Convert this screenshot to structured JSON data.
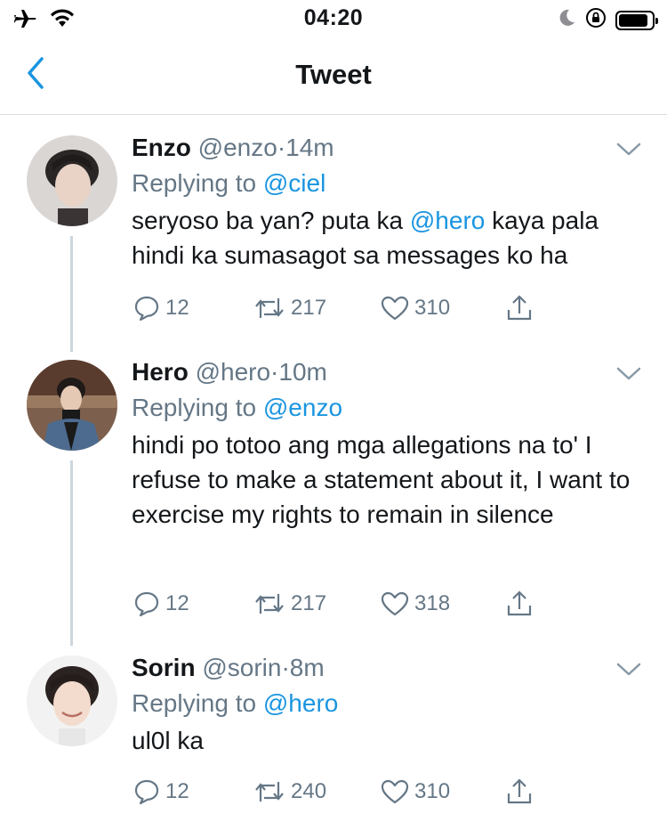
{
  "status_bar": {
    "time": "04:20",
    "icons": [
      "airplane-icon",
      "wifi-icon",
      "moon-icon",
      "orientation-lock-icon",
      "battery-icon"
    ],
    "battery_level": 0.9
  },
  "nav": {
    "title": "Tweet",
    "back_icon": "chevron-left-icon"
  },
  "colors": {
    "accent": "#1b95e0",
    "secondary_text": "#657786",
    "thread_line": "#ccd6dd"
  },
  "tweets": [
    {
      "name": "Enzo",
      "handle": "@enzo",
      "separator": "·",
      "time": "14m",
      "replying_prefix": "Replying to ",
      "replying_to": "@ciel",
      "text_before": "seryoso ba yan? puta ka ",
      "text_mention": "@hero",
      "text_after": " kaya pala hindi ka sumasagot sa messages ko ha",
      "replies": "12",
      "retweets": "217",
      "likes": "310"
    },
    {
      "name": "Hero",
      "handle": "@hero",
      "separator": "·",
      "time": "10m",
      "replying_prefix": "Replying to ",
      "replying_to": "@enzo",
      "text_before": "hindi po totoo ang mga allegations na to' I refuse to make a statement about it, I want to exercise my rights to remain in silence",
      "text_mention": "",
      "text_after": "",
      "replies": "12",
      "retweets": "217",
      "likes": "318"
    },
    {
      "name": "Sorin",
      "handle": "@sorin",
      "separator": "·",
      "time": "8m",
      "replying_prefix": "Replying to ",
      "replying_to": "@hero",
      "text_before": "ul0l ka",
      "text_mention": "",
      "text_after": "",
      "replies": "12",
      "retweets": "240",
      "likes": "310"
    }
  ]
}
